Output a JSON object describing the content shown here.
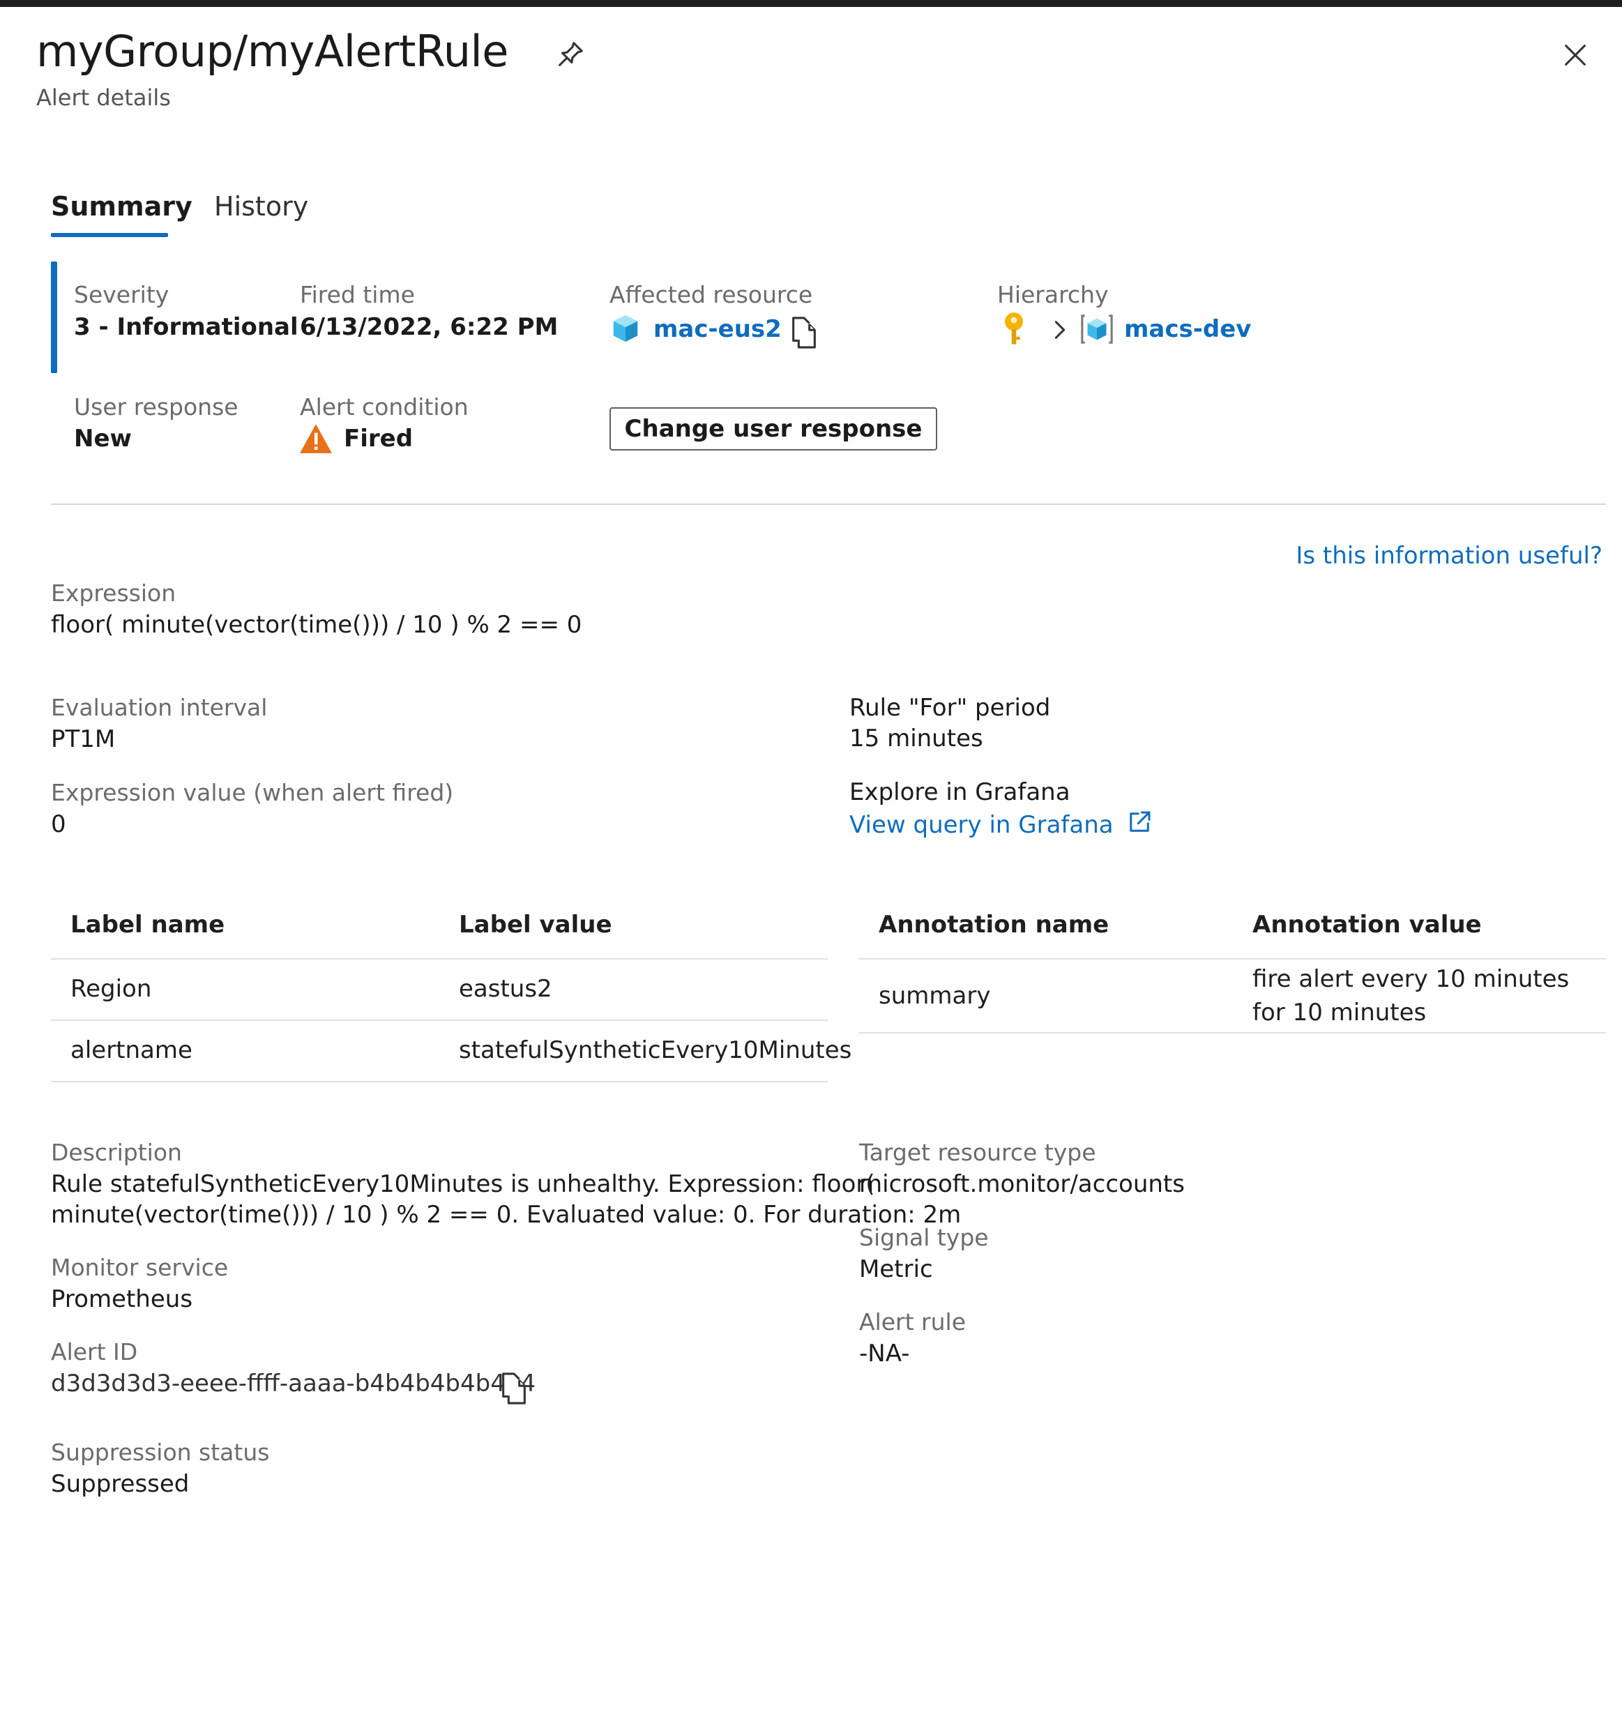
{
  "header": {
    "title": "myGroup/myAlertRule",
    "subtitle": "Alert details"
  },
  "tabs": [
    {
      "label": "Summary",
      "active": true
    },
    {
      "label": "History",
      "active": false
    }
  ],
  "summary": {
    "severity_label": "Severity",
    "severity_value": "3 - Informational",
    "fired_time_label": "Fired time",
    "fired_time_value": "6/13/2022, 6:22 PM",
    "affected_resource_label": "Affected resource",
    "affected_resource_value": "mac-eus2",
    "hierarchy_label": "Hierarchy",
    "hierarchy_value": "macs-dev",
    "user_response_label": "User response",
    "user_response_value": "New",
    "alert_condition_label": "Alert condition",
    "alert_condition_value": "Fired",
    "change_button": "Change user response"
  },
  "feedback_link": "Is this information useful?",
  "details": {
    "expression_label": "Expression",
    "expression_value": "floor( minute(vector(time())) / 10 ) % 2 == 0",
    "evaluation_interval_label": "Evaluation interval",
    "evaluation_interval_value": "PT1M",
    "rule_for_label": "Rule \"For\" period",
    "rule_for_value": "15 minutes",
    "expression_value_label": "Expression value (when alert fired)",
    "expression_value_value": "0",
    "explore_label": "Explore in Grafana",
    "explore_link": "View query in Grafana"
  },
  "labels_table": {
    "headers": [
      "Label name",
      "Label value"
    ],
    "rows": [
      [
        "Region",
        "eastus2"
      ],
      [
        "alertname",
        "statefulSyntheticEvery10Minutes"
      ]
    ]
  },
  "annotations_table": {
    "headers": [
      "Annotation name",
      "Annotation value"
    ],
    "rows": [
      [
        "summary",
        "fire alert every 10 minutes for 10 minutes"
      ]
    ]
  },
  "more": {
    "description_label": "Description",
    "description_line1": "Rule statefulSyntheticEvery10Minutes is unhealthy. Expression: floor(",
    "description_line2": "minute(vector(time())) / 10 ) % 2 == 0. Evaluated value: 0. For duration: 2m",
    "monitor_service_label": "Monitor service",
    "monitor_service_value": "Prometheus",
    "alert_id_label": "Alert ID",
    "alert_id_value": "d3d3d3d3-eeee-ffff-aaaa-b4b4b4b4b4b4",
    "suppression_label": "Suppression status",
    "suppression_value": "Suppressed",
    "target_type_label": "Target resource type",
    "target_type_value": "microsoft.monitor/accounts",
    "signal_type_label": "Signal type",
    "signal_type_value": "Metric",
    "alert_rule_label": "Alert rule",
    "alert_rule_value": "-NA-"
  },
  "icons": {
    "pin": "pin-icon",
    "close": "close-icon",
    "resource": "cube-icon",
    "copy": "copy-icon",
    "subscription": "key-icon",
    "chevron": "chevron-right-icon",
    "resource_group": "resource-group-icon",
    "warning": "warning-icon",
    "external": "external-link-icon"
  },
  "colors": {
    "accent": "#0f6cbd",
    "warning": "#e87018",
    "key": "#f5b400",
    "cube": "#50c8f0"
  }
}
